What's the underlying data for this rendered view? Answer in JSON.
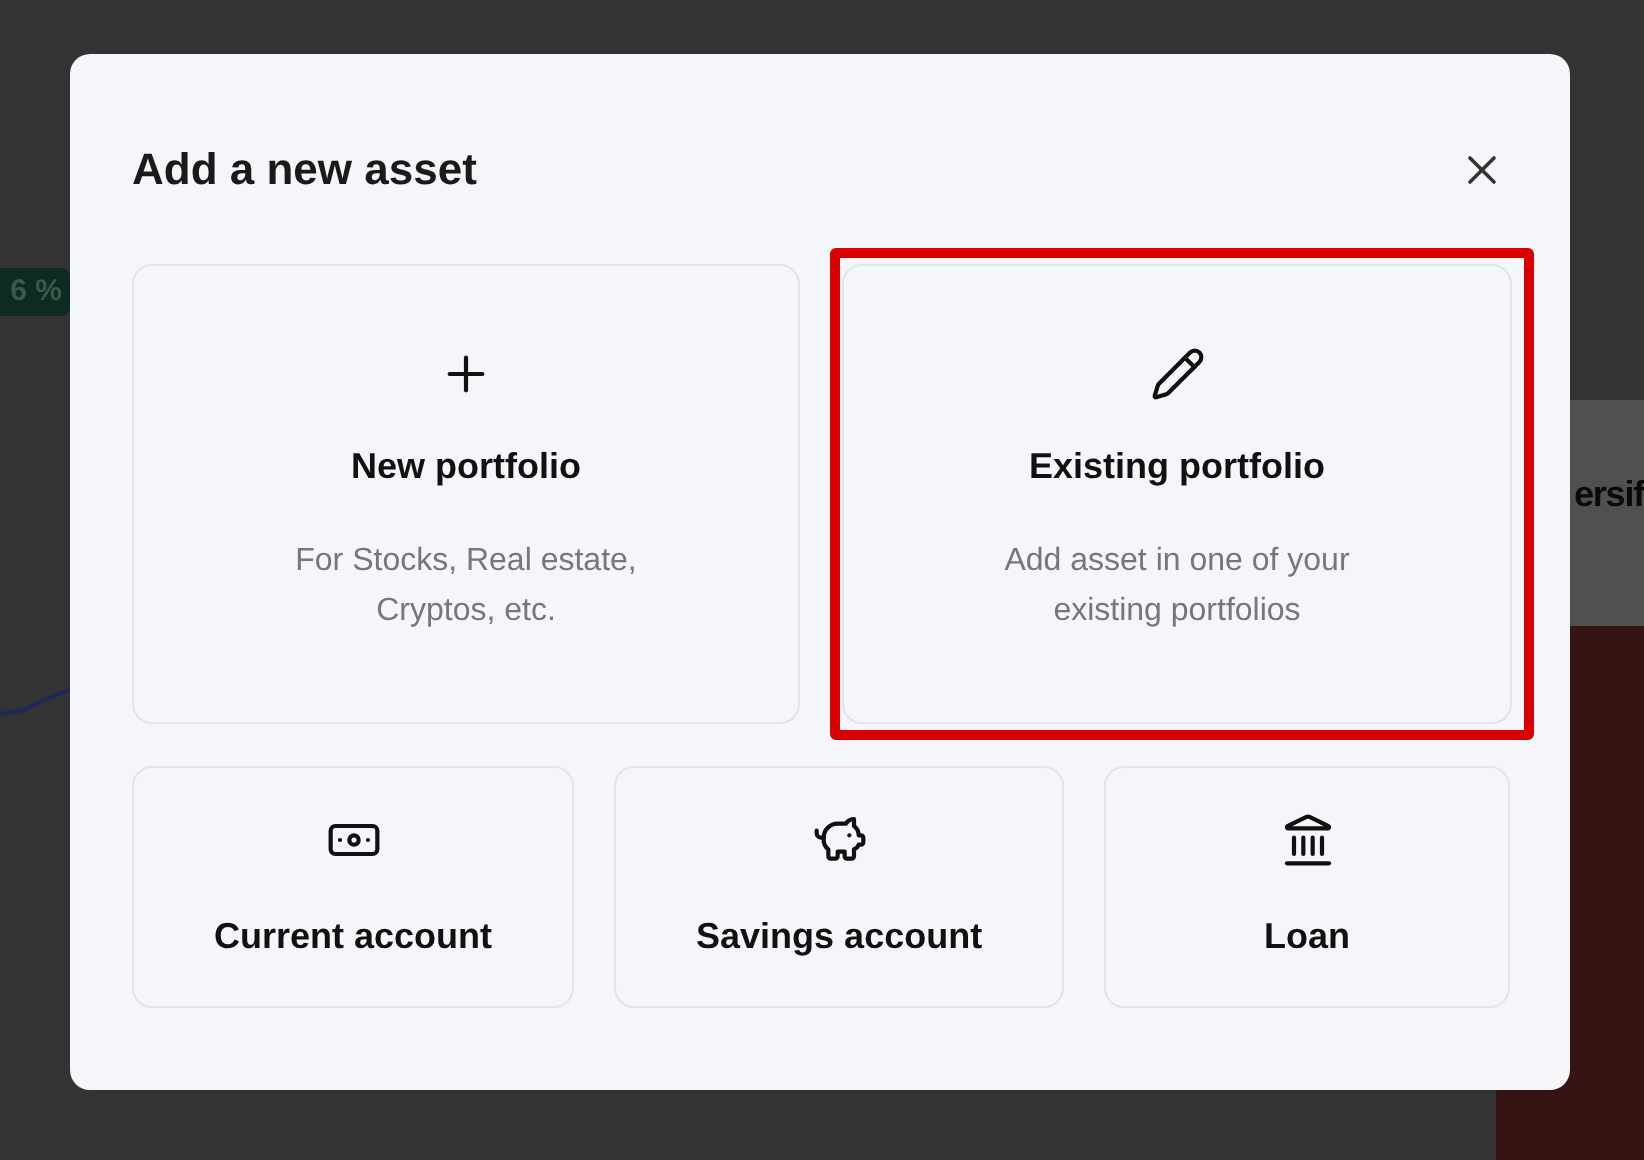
{
  "background": {
    "badge": "6 %",
    "heading": "ersif"
  },
  "dialog": {
    "title": "Add a new asset",
    "options": [
      {
        "kind": "plus",
        "label": "New portfolio",
        "description": "For Stocks, Real estate, Cryptos, etc.",
        "highlighted": false
      },
      {
        "kind": "pencil",
        "label": "Existing portfolio",
        "description": "Add asset in one of your existing portfolios",
        "highlighted": true
      }
    ],
    "accounts": [
      {
        "kind": "banknote",
        "label": "Current account"
      },
      {
        "kind": "piggy",
        "label": "Savings account"
      },
      {
        "kind": "bank",
        "label": "Loan"
      }
    ]
  }
}
